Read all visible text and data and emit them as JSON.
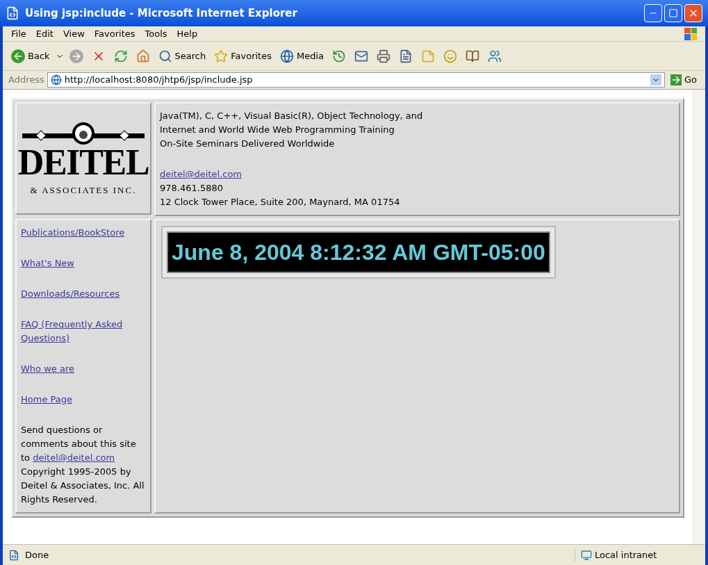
{
  "window": {
    "title": "Using jsp:include - Microsoft Internet Explorer"
  },
  "menu": [
    "File",
    "Edit",
    "View",
    "Favorites",
    "Tools",
    "Help"
  ],
  "toolbar": {
    "back": "Back",
    "search": "Search",
    "favorites": "Favorites",
    "media": "Media"
  },
  "address": {
    "label": "Address",
    "url": "http://localhost:8080/jhtp6/jsp/include.jsp",
    "go": "Go"
  },
  "logo": {
    "name": "DEITEL",
    "tagline": "& ASSOCIATES INC."
  },
  "header": {
    "lines": [
      "Java(TM), C, C++, Visual Basic(R), Object Technology, and",
      "Internet and World Wide Web Programming Training",
      "On-Site Seminars Delivered Worldwide"
    ],
    "email": "deitel@deitel.com",
    "phone": "978.461.5880",
    "street": "12 Clock Tower Place, Suite 200, Maynard, MA 01754"
  },
  "sidebar": {
    "links": [
      "Publications/BookStore",
      "What's New",
      "Downloads/Resources",
      "FAQ (Frequently Asked Questions)",
      "Who we are",
      "Home Page"
    ],
    "footer": {
      "before": "Send questions or comments about this site to ",
      "link": "deitel@deitel.com",
      "after": " Copyright 1995-2005 by Deitel & Associates, Inc. All Rights Reserved."
    }
  },
  "clock": "June 8, 2004 8:12:32 AM GMT-05:00",
  "status_bar": {
    "text": "Done",
    "zone": "Local intranet"
  }
}
